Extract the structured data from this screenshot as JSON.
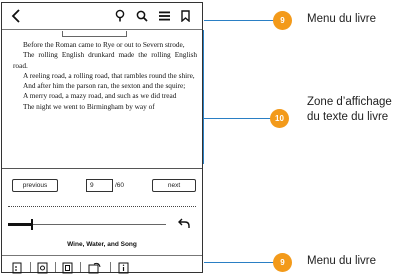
{
  "book": {
    "paragraphs": [
      "Before the Roman came to Rye or out to Severn strode,",
      "The rolling English drunkard made the rolling English road.",
      "A reeling road, a rolling road, that rambles round the shire,",
      "And after him the parson ran, the sexton and the squire;",
      "A merry road, a mazy road, and such as we did tread",
      "The night we went to Birmingham by way of"
    ],
    "title": "Wine, Water, and Song"
  },
  "navigation": {
    "previous_label": "previous",
    "next_label": "next",
    "current_page": "9",
    "total_pages": "/60"
  },
  "progress": {
    "fraction": 0.15
  },
  "toolbar_icons": [
    "back-arrow-icon",
    "bulb-icon",
    "search-icon",
    "menu-icon",
    "bookmark-icon"
  ],
  "bottom_icons": [
    "contents-icon",
    "notes-icon",
    "settings-icon",
    "orientation-icon",
    "info-icon"
  ],
  "annotations": {
    "top": {
      "number": "9",
      "label": "Menu du livre"
    },
    "middle": {
      "number": "10",
      "label_line1": "Zone d’affichage",
      "label_line2": "du texte du livre"
    },
    "bottom": {
      "number": "9",
      "label": "Menu du livre"
    }
  },
  "colors": {
    "badge": "#f39a1a",
    "leader_line": "#2a7fc4"
  }
}
